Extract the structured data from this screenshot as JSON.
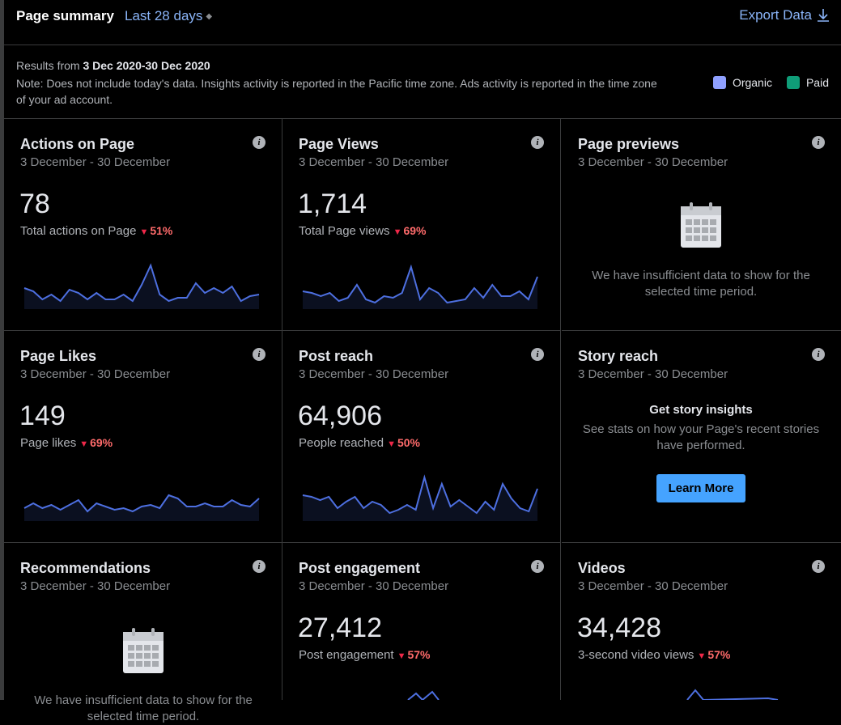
{
  "header": {
    "title": "Page summary",
    "range": "Last 28 days",
    "export_label": "Export Data"
  },
  "info": {
    "results_prefix": "Results from",
    "results_range": "3 Dec 2020-30 Dec 2020",
    "note": "Note: Does not include today's data. Insights activity is reported in the Pacific time zone. Ads activity is reported in the time zone of your ad account."
  },
  "legend": [
    {
      "label": "Organic",
      "color": "#8fa0ff"
    },
    {
      "label": "Paid",
      "color": "#0f9d78"
    }
  ],
  "accent_colors": {
    "spark_line": "#4d6fe0",
    "negative_delta": "#ff6b6b"
  },
  "cards": [
    {
      "title": "Actions on Page",
      "date": "3 December - 30 December",
      "value": "78",
      "sub": "Total actions on Page",
      "delta": "51%",
      "trend": "down",
      "spark": [
        26,
        22,
        12,
        18,
        10,
        24,
        20,
        12,
        20,
        12,
        12,
        18,
        10,
        30,
        54,
        18,
        10,
        14,
        14,
        32,
        20,
        26,
        20,
        28,
        10,
        16,
        18
      ]
    },
    {
      "title": "Page Views",
      "date": "3 December - 30 December",
      "value": "1,714",
      "sub": "Total Page views",
      "delta": "69%",
      "trend": "down",
      "spark": [
        22,
        20,
        16,
        20,
        10,
        14,
        30,
        12,
        8,
        16,
        14,
        20,
        52,
        12,
        26,
        20,
        8,
        10,
        12,
        26,
        14,
        30,
        16,
        16,
        22,
        12,
        40
      ]
    },
    {
      "title": "Page previews",
      "date": "3 December - 30 December",
      "empty_text": "We have insufficient data to show for the selected time period."
    },
    {
      "title": "Page Likes",
      "date": "3 December - 30 December",
      "value": "149",
      "sub": "Page likes",
      "delta": "69%",
      "trend": "down",
      "spark": [
        16,
        22,
        16,
        20,
        14,
        20,
        26,
        12,
        22,
        18,
        14,
        16,
        12,
        18,
        20,
        16,
        32,
        28,
        18,
        18,
        22,
        18,
        18,
        26,
        20,
        18,
        28
      ]
    },
    {
      "title": "Post reach",
      "date": "3 December - 30 December",
      "value": "64,906",
      "sub": "People reached",
      "delta": "50%",
      "trend": "down",
      "spark": [
        32,
        30,
        26,
        30,
        16,
        24,
        30,
        16,
        24,
        20,
        10,
        14,
        20,
        14,
        54,
        16,
        46,
        18,
        26,
        18,
        10,
        24,
        14,
        46,
        28,
        16,
        12,
        40
      ]
    },
    {
      "title": "Story reach",
      "date": "3 December - 30 December",
      "story_title": "Get story insights",
      "story_text": "See stats on how your Page's recent stories have performed.",
      "button_label": "Learn More"
    },
    {
      "title": "Recommendations",
      "date": "3 December - 30 December",
      "empty_text": "We have insufficient data to show for the selected time period."
    },
    {
      "title": "Post engagement",
      "date": "3 December - 30 December",
      "value": "27,412",
      "sub": "Post engagement",
      "delta": "57%",
      "trend": "down"
    },
    {
      "title": "Videos",
      "date": "3 December - 30 December",
      "value": "34,428",
      "sub": "3-second video views",
      "delta": "57%",
      "trend": "down"
    }
  ]
}
